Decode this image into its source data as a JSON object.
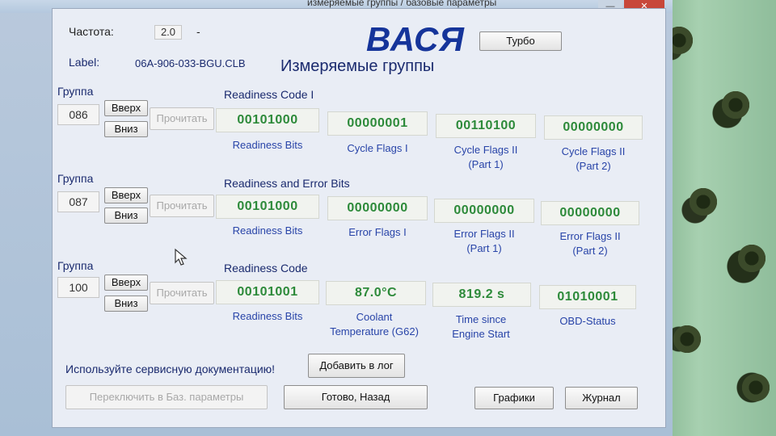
{
  "window": {
    "title": "измеряемые группы / базовые параметры",
    "close_label": "✕",
    "minimize_label": "—"
  },
  "header": {
    "freq_label": "Частота:",
    "freq_value": "2.0",
    "freq_dash": "-",
    "logo": "ВАСЯ",
    "turbo_label": "Турбо",
    "label_key": "Label:",
    "label_value": "06A-906-033-BGU.CLB",
    "section_title": "Измеряемые группы"
  },
  "groups": [
    {
      "group_label": "Группа",
      "number": "086",
      "up_label": "Вверх",
      "down_label": "Вниз",
      "read_label": "Прочитать",
      "title": "Readiness Code I",
      "fields": [
        {
          "value": "00101000",
          "caption": "Readiness Bits"
        },
        {
          "value": "00000001",
          "caption": "Cycle Flags I"
        },
        {
          "value": "00110100",
          "caption": "Cycle Flags II\n(Part 1)"
        },
        {
          "value": "00000000",
          "caption": "Cycle Flags II\n(Part 2)"
        }
      ]
    },
    {
      "group_label": "Группа",
      "number": "087",
      "up_label": "Вверх",
      "down_label": "Вниз",
      "read_label": "Прочитать",
      "title": "Readiness and Error Bits",
      "fields": [
        {
          "value": "00101000",
          "caption": "Readiness Bits"
        },
        {
          "value": "00000000",
          "caption": "Error Flags I"
        },
        {
          "value": "00000000",
          "caption": "Error Flags II\n(Part 1)"
        },
        {
          "value": "00000000",
          "caption": "Error Flags II\n(Part 2)"
        }
      ]
    },
    {
      "group_label": "Группа",
      "number": "100",
      "up_label": "Вверх",
      "down_label": "Вниз",
      "read_label": "Прочитать",
      "title": "Readiness Code",
      "fields": [
        {
          "value": "00101001",
          "caption": "Readiness Bits"
        },
        {
          "value": "87.0°C",
          "caption": "Coolant\nTemperature (G62)"
        },
        {
          "value": "819.2 s",
          "caption": "Time since\nEngine Start"
        },
        {
          "value": "01010001",
          "caption": "OBD-Status"
        }
      ]
    }
  ],
  "footer": {
    "doc_hint": "Используйте сервисную документацию!",
    "add_log_label": "Добавить в лог",
    "switch_label": "Переключить в Баз. параметры",
    "done_label": "Готово, Назад",
    "graphs_label": "Графики",
    "journal_label": "Журнал"
  },
  "colors": {
    "value_green": "#2d8a3a",
    "caption_blue": "#2844a8",
    "logo_blue": "#15349a"
  }
}
